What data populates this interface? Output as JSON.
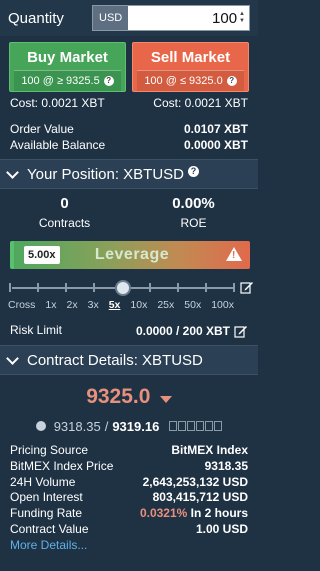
{
  "quantity": {
    "label": "Quantity",
    "currency": "USD",
    "value": "100"
  },
  "buy": {
    "title": "Buy Market",
    "sub": "100 @ ≥ 9325.5"
  },
  "sell": {
    "title": "Sell Market",
    "sub": "100 @ ≤ 9325.0"
  },
  "cost": {
    "buy": "Cost: 0.0021 XBT",
    "sell": "Cost: 0.0021 XBT"
  },
  "order_value": {
    "label": "Order Value",
    "value": "0.0107 XBT"
  },
  "available_balance": {
    "label": "Available Balance",
    "value": "0.0000 XBT"
  },
  "position": {
    "header": "Your Position: XBTUSD",
    "contracts_value": "0",
    "contracts_label": "Contracts",
    "roe_value": "0.00%",
    "roe_label": "ROE"
  },
  "leverage": {
    "current": "5.00x",
    "label": "Leverage",
    "level": 0.333,
    "ticks": [
      "Cross",
      "1x",
      "2x",
      "3x",
      "5x",
      "10x",
      "25x",
      "50x",
      "100x"
    ],
    "selected": "5x"
  },
  "risk_limit": {
    "label": "Risk Limit",
    "value": "0.0000 / 200 XBT"
  },
  "contract": {
    "header": "Contract Details: XBTUSD",
    "last_price": "9325.0",
    "index_price": "9318.35",
    "mark_price": "9319.16",
    "rows": [
      {
        "label": "Pricing Source",
        "value": "BitMEX Index"
      },
      {
        "label": "BitMEX Index Price",
        "value": "9318.35"
      },
      {
        "label": "24H Volume",
        "value": "2,643,253,132 USD"
      },
      {
        "label": "Open Interest",
        "value": "803,415,712 USD"
      }
    ],
    "funding": {
      "label": "Funding Rate",
      "rate": "0.0321%",
      "time": "In 2 hours"
    },
    "contract_value": {
      "label": "Contract Value",
      "value": "1.00 USD"
    },
    "more": "More Details..."
  },
  "colors": {
    "buy": "#47a55a",
    "sell": "#e8674a",
    "price_down": "#e8907e",
    "link": "#5fb0e8"
  }
}
